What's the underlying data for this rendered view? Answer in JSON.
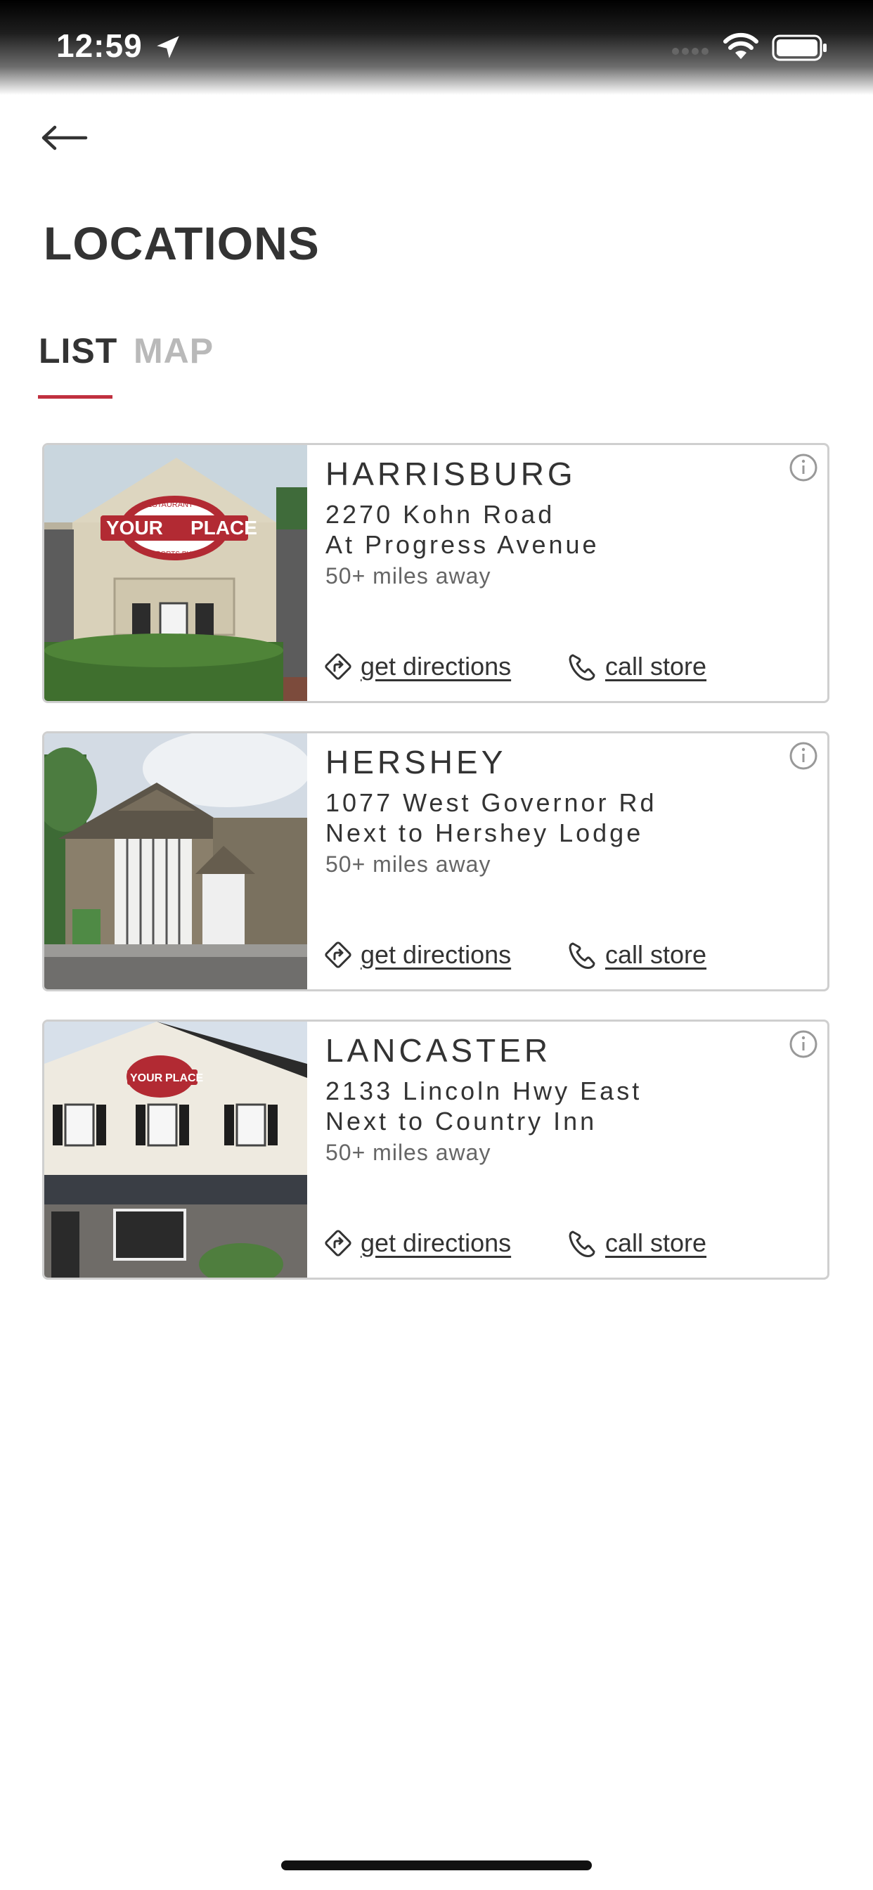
{
  "status_bar": {
    "time": "12:59",
    "icons": [
      "location-arrow-icon",
      "signal-icon",
      "wifi-icon",
      "battery-icon"
    ]
  },
  "header": {
    "back_icon": "arrow-left-icon",
    "title": "LOCATIONS"
  },
  "tabs": [
    {
      "label": "LIST",
      "active": true
    },
    {
      "label": "MAP",
      "active": false
    }
  ],
  "colors": {
    "accent": "#c0303f",
    "text": "#333333",
    "muted": "#b9b9b9",
    "border": "#cfcfcf"
  },
  "locations": [
    {
      "city": "HARRISBURG",
      "address_line1": "2270 Kohn Road",
      "address_line2": "At Progress Avenue",
      "distance": "50+ miles away",
      "directions_label": "get directions",
      "call_label": "call store"
    },
    {
      "city": "HERSHEY",
      "address_line1": "1077 West Governor Rd",
      "address_line2": "Next to Hershey Lodge",
      "distance": "50+ miles away",
      "directions_label": "get directions",
      "call_label": "call store"
    },
    {
      "city": "LANCASTER",
      "address_line1": "2133 Lincoln Hwy East",
      "address_line2": "Next to Country Inn",
      "distance": "50+ miles away",
      "directions_label": "get directions",
      "call_label": "call store"
    }
  ],
  "photo_signage": {
    "line1": "RESTAURANT",
    "logo_left": "YOUR",
    "logo_right": "PLACE",
    "line2": "SPORTS PUB"
  }
}
